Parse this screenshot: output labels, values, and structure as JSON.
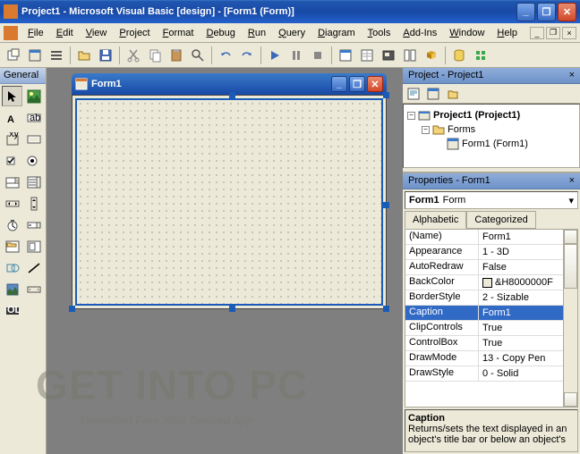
{
  "window": {
    "title": "Project1 - Microsoft Visual Basic [design] - [Form1 (Form)]"
  },
  "menu": [
    "File",
    "Edit",
    "View",
    "Project",
    "Format",
    "Debug",
    "Run",
    "Query",
    "Diagram",
    "Tools",
    "Add-Ins",
    "Window",
    "Help"
  ],
  "toolbox": {
    "title": "General"
  },
  "form": {
    "title": "Form1"
  },
  "project": {
    "title": "Project - Project1",
    "root": "Project1 (Project1)",
    "folder": "Forms",
    "item": "Form1 (Form1)"
  },
  "properties": {
    "title": "Properties - Form1",
    "object_name": "Form1",
    "object_type": "Form",
    "tabs": {
      "alpha": "Alphabetic",
      "cat": "Categorized"
    },
    "rows": [
      {
        "name": "(Name)",
        "value": "Form1"
      },
      {
        "name": "Appearance",
        "value": "1 - 3D"
      },
      {
        "name": "AutoRedraw",
        "value": "False"
      },
      {
        "name": "BackColor",
        "value": "&H8000000F",
        "swatch": true
      },
      {
        "name": "BorderStyle",
        "value": "2 - Sizable"
      },
      {
        "name": "Caption",
        "value": "Form1",
        "selected": true
      },
      {
        "name": "ClipControls",
        "value": "True"
      },
      {
        "name": "ControlBox",
        "value": "True"
      },
      {
        "name": "DrawMode",
        "value": "13 - Copy Pen"
      },
      {
        "name": "DrawStyle",
        "value": "0 - Solid"
      }
    ],
    "desc_title": "Caption",
    "desc_text": "Returns/sets the text displayed in an object's title bar or below an object's"
  },
  "watermark": {
    "main": "GET INTO PC",
    "sub": "Download Free Your Desired App"
  }
}
